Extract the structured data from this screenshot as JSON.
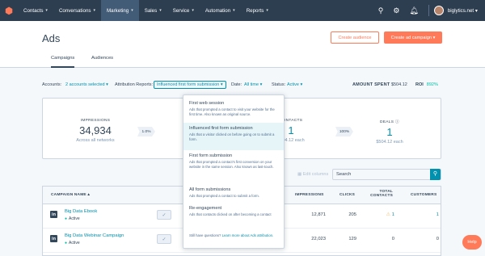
{
  "nav": {
    "logo": "⬢",
    "items": [
      {
        "label": "Contacts"
      },
      {
        "label": "Conversations"
      },
      {
        "label": "Marketing"
      },
      {
        "label": "Sales"
      },
      {
        "label": "Service"
      },
      {
        "label": "Automation"
      },
      {
        "label": "Reports"
      }
    ],
    "account": "biglytics.net"
  },
  "header": {
    "title": "Ads",
    "create_audience": "Create audience",
    "create_campaign": "Create ad campaign",
    "tabs": [
      {
        "label": "Campaigns"
      },
      {
        "label": "Audiences"
      }
    ]
  },
  "filters": {
    "accounts_label": "Accounts:",
    "accounts_value": "2 accounts selected",
    "attribution_label": "Attribution Reports:",
    "attribution_value": "Influenced first form submission",
    "date_label": "Date:",
    "date_value": "All time",
    "status_label": "Status:",
    "status_value": "Active",
    "amount_spent_label": "AMOUNT SPENT",
    "amount_spent_value": "$504.12",
    "roi_label": "ROI",
    "roi_value": "892%"
  },
  "funnel": {
    "impressions_label": "IMPRESSIONS",
    "impressions_value": "34,934",
    "impressions_sub": "Across all networks",
    "rate1": "1.0%",
    "contacts_label": "CONTACTS",
    "contacts_value": "1",
    "contacts_sub": "$504.12 each",
    "rate2": "100%",
    "deals_label": "DEALS",
    "deals_value": "1",
    "deals_sub": "$504.12 each"
  },
  "toolbar": {
    "edit_columns": "Edit columns",
    "search_placeholder": "Search"
  },
  "table": {
    "headers": {
      "campaign": "CAMPAIGN NAME",
      "impressions": "IMPRESSIONS",
      "clicks": "CLICKS",
      "total_contacts_1": "TOTAL",
      "total_contacts_2": "CONTACTS",
      "customers": "CUSTOMERS"
    },
    "rows": [
      {
        "name": "Big Data Ebook",
        "status": "Active",
        "impressions": "12,871",
        "clicks": "205",
        "contacts": "1",
        "customers": "1"
      },
      {
        "name": "Big Data Webinar Campaign",
        "status": "Active",
        "impressions": "22,023",
        "clicks": "129",
        "contacts": "0",
        "customers": "0"
      }
    ]
  },
  "dropdown": {
    "options": [
      {
        "title": "First web session",
        "desc": "Ads that prompted a contact to visit your website for the first time. Also known as original source."
      },
      {
        "title": "Influenced first form submission",
        "desc": "Ads that a visitor clicked on before going on to submit a form."
      },
      {
        "title": "First form submission",
        "desc": "Ads that prompted a contact's first conversion on your website in the same session. Also known as last-touch."
      },
      {
        "title": "All form submissions",
        "desc": "Ads that prompted a contact to submit a form."
      },
      {
        "title": "Re-engagement",
        "desc": "Ads that contacts clicked on after becoming a contact"
      }
    ],
    "footer_text": "Still have questions?",
    "footer_link": "Learn more about Ads attribution."
  },
  "help_label": "Help",
  "colors": {
    "brand": "#ff7a59",
    "nav": "#2d3e50",
    "link": "#0091ae",
    "accent": "#00bda5"
  }
}
